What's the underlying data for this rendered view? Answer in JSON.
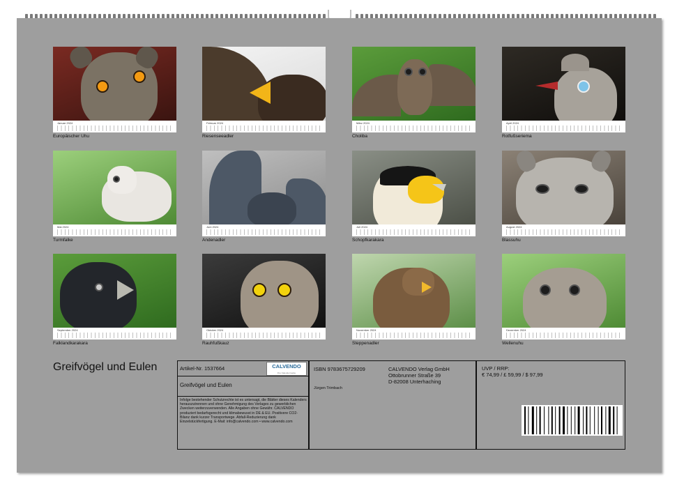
{
  "months": [
    {
      "name": "Januar 2024",
      "caption": "Europäischer Uhu"
    },
    {
      "name": "Februar 2024",
      "caption": "Riesenseeadler"
    },
    {
      "name": "März 2024",
      "caption": "Choliba"
    },
    {
      "name": "April 2024",
      "caption": "Rotfußseriema"
    },
    {
      "name": "Mai 2024",
      "caption": "Turmfalke"
    },
    {
      "name": "Juni 2024",
      "caption": "Andenadler"
    },
    {
      "name": "Juli 2024",
      "caption": "Schopfkarakara"
    },
    {
      "name": "August 2024",
      "caption": "Blassuhu"
    },
    {
      "name": "September 2024",
      "caption": "Falklandkarakara"
    },
    {
      "name": "Oktober 2024",
      "caption": "Rauhfußkauz"
    },
    {
      "name": "November 2024",
      "caption": "Steppenadler"
    },
    {
      "name": "Dezember 2024",
      "caption": "Wellenuhu"
    }
  ],
  "back_title": "Greifvögel und Eulen",
  "article_no": "Artikel-Nr. 1537664",
  "logo": {
    "text": "CALVENDO",
    "sub": "Ihre Kalendermarke"
  },
  "product_title": "Greifvögel und Eulen",
  "legal_text": "Infolge bestehender Schutzrechte ist es untersagt, die Blätter dieses Kalenders herauszutrennen und ohne Genehmigung des Verlages zu gewerblichen Zwecken weiterzuverwenden. Alle Angaben ohne Gewähr. CALVENDO produziert bedarfsgerecht und klimabewusst in DE & EU. Positivere CO2-Bilanz dank kurzer Transportwege. Abfall-Reduzierung dank Einzelstückfertigung. E-Mail: info@calvendo.com • www.calvendo.com",
  "isbn": "ISBN 9783675729209",
  "author": "Jürgen Trimbach",
  "publisher": [
    "CALVENDO Verlag GmbH",
    "Ottobrunner Straße 39",
    "D-82008 Unterhaching"
  ],
  "price_label": "UVP / RRP:",
  "prices": "€ 74,99 / £ 59,99 / $ 97,99"
}
